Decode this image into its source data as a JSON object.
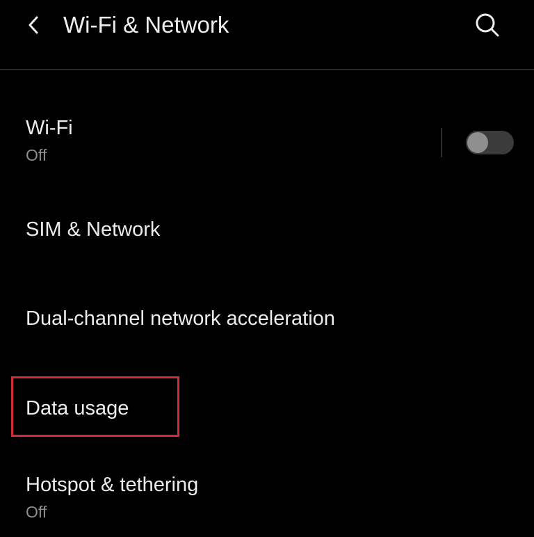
{
  "header": {
    "title": "Wi-Fi & Network",
    "back_icon": "chevron-left-icon",
    "search_icon": "search-icon"
  },
  "items": [
    {
      "title": "Wi-Fi",
      "subtitle": "Off",
      "toggle_on": false
    },
    {
      "title": "SIM & Network"
    },
    {
      "title": "Dual-channel network acceleration"
    },
    {
      "title": "Data usage",
      "highlighted": true
    },
    {
      "title": "Hotspot & tethering",
      "subtitle": "Off"
    }
  ],
  "colors": {
    "background": "#000000",
    "text_primary": "#ececec",
    "text_secondary": "#8e8e8e",
    "highlight": "#d32b38",
    "toggle_track_off": "#3b3b3b",
    "toggle_knob_off": "#8f8f8f"
  }
}
